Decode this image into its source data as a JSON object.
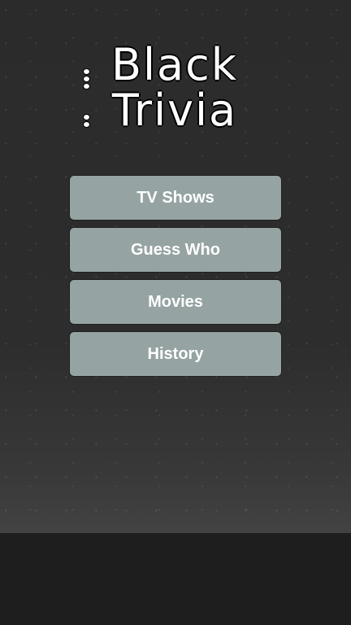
{
  "logo": {
    "line1": "Black",
    "line2": "Trivia"
  },
  "menu": {
    "items": [
      {
        "label": "TV Shows"
      },
      {
        "label": "Guess Who"
      },
      {
        "label": "Movies"
      },
      {
        "label": "History"
      }
    ]
  },
  "colors": {
    "button": "#95a3a2",
    "background": "#2d2d2d"
  }
}
